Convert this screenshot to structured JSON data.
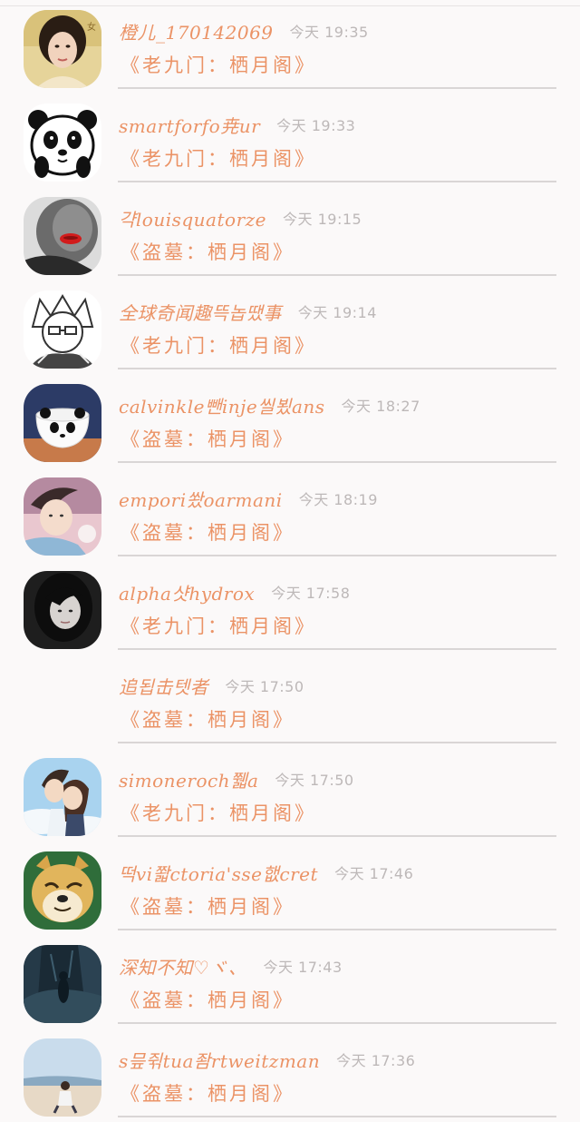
{
  "entries": [
    {
      "username": "橙儿_170142069",
      "time": "今天 19:35",
      "book": "《老九门：栖月阁》",
      "avatar": "woman-portrait"
    },
    {
      "username": "smartforfo尭ur",
      "time": "今天 19:33",
      "book": "《老九门：栖月阁》",
      "avatar": "panda"
    },
    {
      "username": "갹louisquatorze",
      "time": "今天 19:15",
      "book": "《盗墓：栖月阁》",
      "avatar": "man-lips"
    },
    {
      "username": "全球奇闻趣뜩놉땠事",
      "time": "今天 19:14",
      "book": "《老九门：栖月阁》",
      "avatar": "anime-boy"
    },
    {
      "username": "calvinkle뺀inje씰뵜ans",
      "time": "今天 18:27",
      "book": "《盗墓：栖月阁》",
      "avatar": "panda-cup"
    },
    {
      "username": "empori쐈oarmani",
      "time": "今天 18:19",
      "book": "《盗墓：栖月阁》",
      "avatar": "boy-pink"
    },
    {
      "username": "alpha샷hydrox",
      "time": "今天 17:58",
      "book": "《老九门：栖月阁》",
      "avatar": "girl-dark"
    },
    {
      "username": "追됩击텟者",
      "time": "今天 17:50",
      "book": "《盗墓：栖月阁》",
      "avatar": "none"
    },
    {
      "username": "simoneroch쮋a",
      "time": "今天 17:50",
      "book": "《老九门：栖月阁》",
      "avatar": "anime-couple"
    },
    {
      "username": "떡vi쫣ctoria'sse햆cret",
      "time": "今天 17:46",
      "book": "《盗墓：栖月阁》",
      "avatar": "doge"
    },
    {
      "username": "深知不知♡ヾ、",
      "time": "今天 17:43",
      "book": "《盗墓：栖月阁》",
      "avatar": "dark-forest"
    },
    {
      "username": "s믚쥒tua좜rtweitzman",
      "time": "今天 17:36",
      "book": "《盗墓：栖月阁》",
      "avatar": "beach"
    }
  ],
  "colors": {
    "accent": "#eb9366",
    "time": "#bdb8b8",
    "divider": "#d9d6d6",
    "background": "#fbf9f9"
  }
}
